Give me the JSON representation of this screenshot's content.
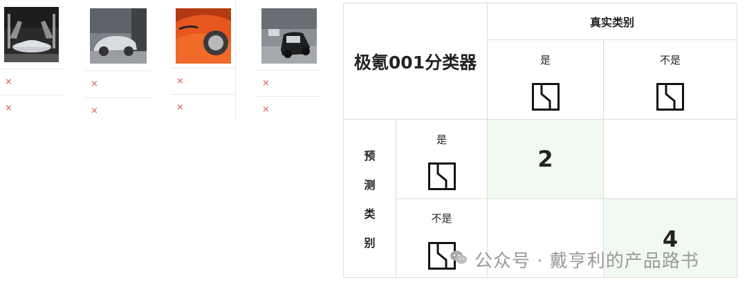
{
  "gallery": {
    "columns": [
      {
        "image": "silver-sports-car-doors-open",
        "rows": [
          "×",
          "×"
        ]
      },
      {
        "image": "silver-suv-on-street",
        "rows": [
          "×",
          "×"
        ]
      },
      {
        "image": "orange-sports-car",
        "rows": [
          "×",
          "×"
        ]
      },
      {
        "image": "small-black-car-street",
        "rows": [
          "×",
          "×"
        ]
      }
    ]
  },
  "matrix": {
    "title": "极氪001分类器",
    "actual_header": "真实类别",
    "predicted_header_chars": [
      "预",
      "测",
      "类",
      "别"
    ],
    "col_yes": "是",
    "col_no": "不是",
    "row_yes": "是",
    "row_no": "不是",
    "cells": {
      "yes_yes": "2",
      "yes_no": "",
      "no_yes": "",
      "no_no": "4"
    },
    "icon": "door-icon",
    "highlight_color": "#f0faf0"
  },
  "watermark": {
    "text": "公众号 · 戴亨利的产品路书"
  }
}
